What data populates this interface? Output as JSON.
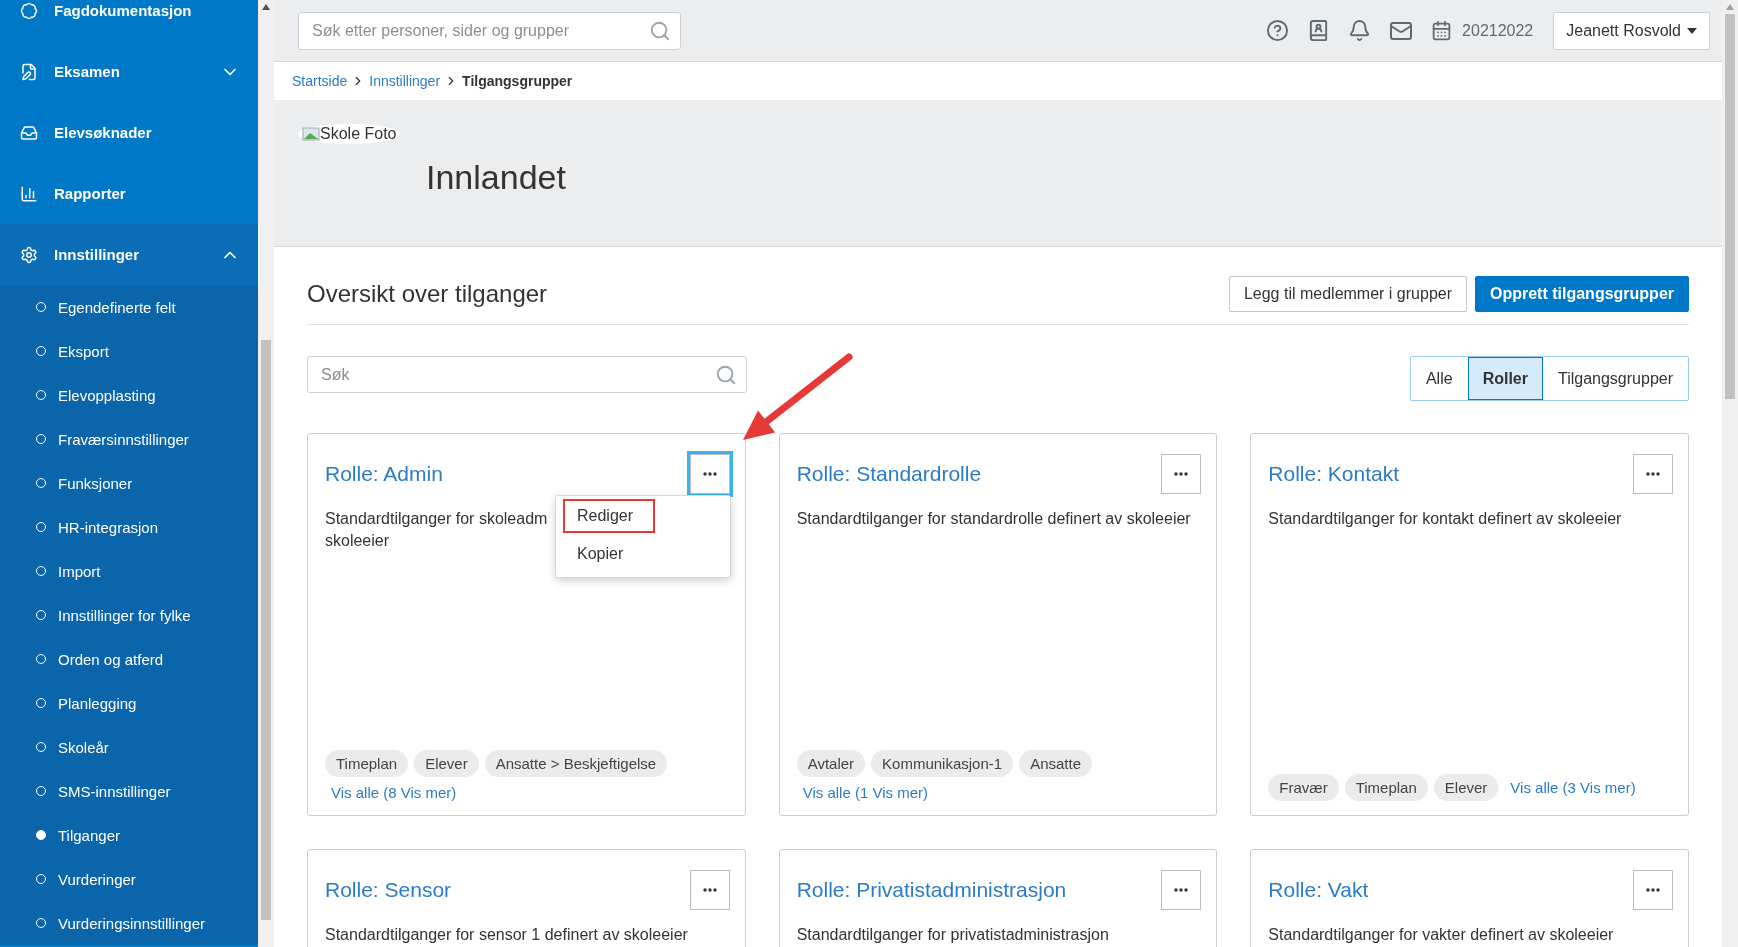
{
  "sidebar": {
    "items": [
      {
        "label": "Fagdokumentasjon"
      },
      {
        "label": "Eksamen",
        "expanded": false
      },
      {
        "label": "Elevsøknader"
      },
      {
        "label": "Rapporter"
      },
      {
        "label": "Innstillinger",
        "expanded": true,
        "children": [
          {
            "label": "Egendefinerte felt",
            "selected": false
          },
          {
            "label": "Eksport",
            "selected": false
          },
          {
            "label": "Elevopplasting",
            "selected": false
          },
          {
            "label": "Fraværsinnstillinger",
            "selected": false
          },
          {
            "label": "Funksjoner",
            "selected": false
          },
          {
            "label": "HR-integrasjon",
            "selected": false
          },
          {
            "label": "Import",
            "selected": false
          },
          {
            "label": "Innstillinger for fylke",
            "selected": false
          },
          {
            "label": "Orden og atferd",
            "selected": false
          },
          {
            "label": "Planlegging",
            "selected": false
          },
          {
            "label": "Skoleår",
            "selected": false
          },
          {
            "label": "SMS-innstillinger",
            "selected": false
          },
          {
            "label": "Tilganger",
            "selected": true
          },
          {
            "label": "Vurderinger",
            "selected": false
          },
          {
            "label": "Vurderingsinnstillinger",
            "selected": false
          }
        ]
      }
    ]
  },
  "topbar": {
    "search_placeholder": "Søk etter personer, sider og grupper",
    "school_year": "20212022",
    "user": "Jeanett Rosvold"
  },
  "breadcrumb": [
    {
      "label": "Startside",
      "current": false
    },
    {
      "label": "Innstillinger",
      "current": false
    },
    {
      "label": "Tilgangsgrupper",
      "current": true
    }
  ],
  "header": {
    "image_alt": "Skole Foto",
    "title": "Innlandet"
  },
  "section": {
    "title": "Oversikt over tilganger",
    "buttons": [
      {
        "label": "Legg til medlemmer i grupper",
        "kind": "secondary"
      },
      {
        "label": "Opprett tilgangsgrupper",
        "kind": "primary"
      }
    ],
    "search_placeholder": "Søk",
    "filters": [
      {
        "label": "Alle",
        "selected": false
      },
      {
        "label": "Roller",
        "selected": true
      },
      {
        "label": "Tilgangsgrupper",
        "selected": false
      }
    ]
  },
  "cards": [
    {
      "title": "Rolle: Admin",
      "description": "Standardtilganger for skoleadm\nskoleeier",
      "tags": [
        "Timeplan",
        "Elever",
        "Ansatte > Beskjeftigelse"
      ],
      "more_link": "Vis alle (8 Vis mer)",
      "menu_open": true,
      "menu": [
        {
          "label": "Rediger",
          "highlighted": true
        },
        {
          "label": "Kopier",
          "highlighted": false
        }
      ]
    },
    {
      "title": "Rolle: Standardrolle",
      "description": "Standardtilganger for standardrolle definert av skoleeier",
      "tags": [
        "Avtaler",
        "Kommunikasjon-1",
        "Ansatte"
      ],
      "more_link": "Vis alle (1 Vis mer)",
      "menu_open": false
    },
    {
      "title": "Rolle: Kontakt",
      "description": "Standardtilganger for kontakt definert av skoleeier",
      "tags": [
        "Fravær",
        "Timeplan",
        "Elever"
      ],
      "more_link": "Vis alle (3 Vis mer)",
      "menu_open": false
    },
    {
      "title": "Rolle: Sensor",
      "description": "Standardtilganger for sensor 1 definert av skoleeier",
      "menu_open": false
    },
    {
      "title": "Rolle: Privatistadministrasjon",
      "description": "Standardtilganger for privatistadministrasjon",
      "menu_open": false
    },
    {
      "title": "Rolle: Vakt",
      "description": "Standardtilganger for vakter definert av skoleeier",
      "menu_open": false
    }
  ],
  "annotation": {
    "kind": "arrow"
  }
}
